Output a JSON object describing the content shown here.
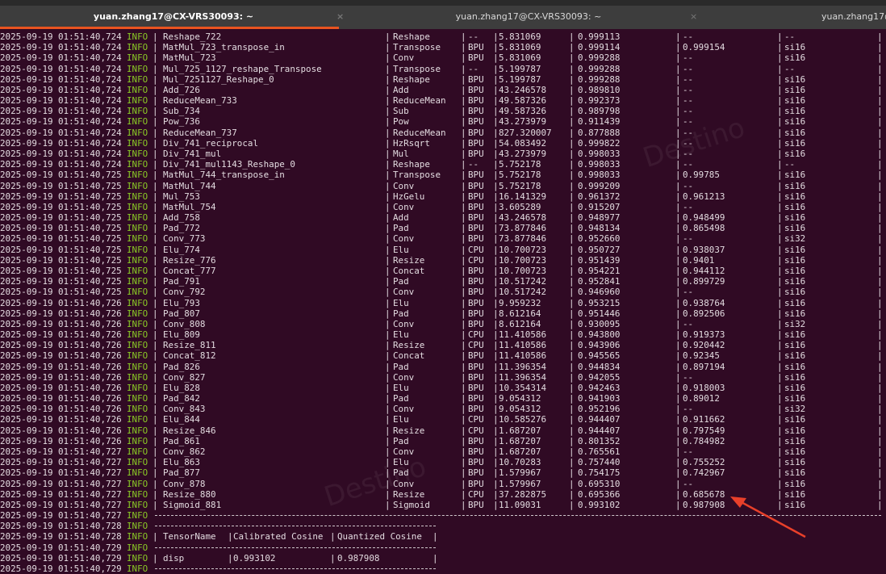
{
  "tabs": [
    {
      "title": "yuan.zhang17@CX-VRS30093: ~",
      "active": true
    },
    {
      "title": "yuan.zhang17@CX-VRS30093: ~",
      "active": false
    },
    {
      "title": "yuan.zhang17@",
      "active": false
    }
  ],
  "close_glyph": "×",
  "accent": "#e95420",
  "background": "#300a24",
  "level_color": "#8ac926",
  "watermark": "Destino",
  "date": "2025-09-19",
  "level": "INFO",
  "rows": [
    [
      "01:51:40,724",
      "Reshape_722",
      "Reshape",
      "--",
      "5.831069",
      "0.999113",
      "--",
      "--"
    ],
    [
      "01:51:40,724",
      "MatMul_723_transpose_in",
      "Transpose",
      "BPU",
      "5.831069",
      "0.999114",
      "0.999154",
      "si16"
    ],
    [
      "01:51:40,724",
      "MatMul_723",
      "Conv",
      "BPU",
      "5.831069",
      "0.999288",
      "--",
      "si16"
    ],
    [
      "01:51:40,724",
      "Mul_725_1127_reshape_Transpose",
      "Transpose",
      "--",
      "5.199787",
      "0.999288",
      "--",
      "--"
    ],
    [
      "01:51:40,724",
      "Mul_7251127_Reshape_0",
      "Reshape",
      "BPU",
      "5.199787",
      "0.999288",
      "--",
      "si16"
    ],
    [
      "01:51:40,724",
      "Add_726",
      "Add",
      "BPU",
      "43.246578",
      "0.989810",
      "--",
      "si16"
    ],
    [
      "01:51:40,724",
      "ReduceMean_733",
      "ReduceMean",
      "BPU",
      "49.587326",
      "0.992373",
      "--",
      "si16"
    ],
    [
      "01:51:40,724",
      "Sub_734",
      "Sub",
      "BPU",
      "49.587326",
      "0.989798",
      "--",
      "si16"
    ],
    [
      "01:51:40,724",
      "Pow_736",
      "Pow",
      "BPU",
      "43.273979",
      "0.911439",
      "--",
      "si16"
    ],
    [
      "01:51:40,724",
      "ReduceMean_737",
      "ReduceMean",
      "BPU",
      "827.320007",
      "0.877888",
      "--",
      "si16"
    ],
    [
      "01:51:40,724",
      "Div_741_reciprocal",
      "HzRsqrt",
      "BPU",
      "54.083492",
      "0.999822",
      "--",
      "si16"
    ],
    [
      "01:51:40,724",
      "Div_741_mul",
      "Mul",
      "BPU",
      "43.273979",
      "0.998033",
      "--",
      "si16"
    ],
    [
      "01:51:40,724",
      "Div_741_mul1143_Reshape_0",
      "Reshape",
      "--",
      "5.752178",
      "0.998033",
      "--",
      "--"
    ],
    [
      "01:51:40,725",
      "MatMul_744_transpose_in",
      "Transpose",
      "BPU",
      "5.752178",
      "0.998033",
      "0.99785",
      "si16"
    ],
    [
      "01:51:40,725",
      "MatMul_744",
      "Conv",
      "BPU",
      "5.752178",
      "0.999209",
      "--",
      "si16"
    ],
    [
      "01:51:40,725",
      "Mul_753",
      "HzGelu",
      "BPU",
      "16.141329",
      "0.961372",
      "0.961213",
      "si16"
    ],
    [
      "01:51:40,725",
      "MatMul_754",
      "Conv",
      "BPU",
      "3.605289",
      "0.915207",
      "--",
      "si16"
    ],
    [
      "01:51:40,725",
      "Add_758",
      "Add",
      "BPU",
      "43.246578",
      "0.948977",
      "0.948499",
      "si16"
    ],
    [
      "01:51:40,725",
      "Pad_772",
      "Pad",
      "BPU",
      "73.877846",
      "0.948134",
      "0.865498",
      "si16"
    ],
    [
      "01:51:40,725",
      "Conv_773",
      "Conv",
      "BPU",
      "73.877846",
      "0.952660",
      "--",
      "si32"
    ],
    [
      "01:51:40,725",
      "Elu_774",
      "Elu",
      "CPU",
      "10.700723",
      "0.950727",
      "0.938037",
      "si16"
    ],
    [
      "01:51:40,725",
      "Resize_776",
      "Resize",
      "CPU",
      "10.700723",
      "0.951439",
      "0.9401",
      "si16"
    ],
    [
      "01:51:40,725",
      "Concat_777",
      "Concat",
      "BPU",
      "10.700723",
      "0.954221",
      "0.944112",
      "si16"
    ],
    [
      "01:51:40,725",
      "Pad_791",
      "Pad",
      "BPU",
      "10.517242",
      "0.952841",
      "0.899729",
      "si16"
    ],
    [
      "01:51:40,725",
      "Conv_792",
      "Conv",
      "BPU",
      "10.517242",
      "0.946960",
      "--",
      "si16"
    ],
    [
      "01:51:40,726",
      "Elu_793",
      "Elu",
      "BPU",
      "9.959232",
      "0.953215",
      "0.938764",
      "si16"
    ],
    [
      "01:51:40,726",
      "Pad_807",
      "Pad",
      "BPU",
      "8.612164",
      "0.951446",
      "0.892506",
      "si16"
    ],
    [
      "01:51:40,726",
      "Conv_808",
      "Conv",
      "BPU",
      "8.612164",
      "0.930095",
      "--",
      "si32"
    ],
    [
      "01:51:40,726",
      "Elu_809",
      "Elu",
      "CPU",
      "11.410586",
      "0.943800",
      "0.919373",
      "si16"
    ],
    [
      "01:51:40,726",
      "Resize_811",
      "Resize",
      "CPU",
      "11.410586",
      "0.943906",
      "0.920442",
      "si16"
    ],
    [
      "01:51:40,726",
      "Concat_812",
      "Concat",
      "BPU",
      "11.410586",
      "0.945565",
      "0.92345",
      "si16"
    ],
    [
      "01:51:40,726",
      "Pad_826",
      "Pad",
      "BPU",
      "11.396354",
      "0.944834",
      "0.897194",
      "si16"
    ],
    [
      "01:51:40,726",
      "Conv_827",
      "Conv",
      "BPU",
      "11.396354",
      "0.942055",
      "--",
      "si16"
    ],
    [
      "01:51:40,726",
      "Elu_828",
      "Elu",
      "BPU",
      "10.354314",
      "0.942463",
      "0.918003",
      "si16"
    ],
    [
      "01:51:40,726",
      "Pad_842",
      "Pad",
      "BPU",
      "9.054312",
      "0.941903",
      "0.89012",
      "si16"
    ],
    [
      "01:51:40,726",
      "Conv_843",
      "Conv",
      "BPU",
      "9.054312",
      "0.952196",
      "--",
      "si32"
    ],
    [
      "01:51:40,726",
      "Elu_844",
      "Elu",
      "CPU",
      "10.585276",
      "0.944407",
      "0.911662",
      "si16"
    ],
    [
      "01:51:40,726",
      "Resize_846",
      "Resize",
      "CPU",
      "1.687207",
      "0.944407",
      "0.797549",
      "si16"
    ],
    [
      "01:51:40,726",
      "Pad_861",
      "Pad",
      "BPU",
      "1.687207",
      "0.801352",
      "0.784982",
      "si16"
    ],
    [
      "01:51:40,727",
      "Conv_862",
      "Conv",
      "BPU",
      "1.687207",
      "0.765561",
      "--",
      "si16"
    ],
    [
      "01:51:40,727",
      "Elu_863",
      "Elu",
      "BPU",
      "10.70283",
      "0.757440",
      "0.755252",
      "si16"
    ],
    [
      "01:51:40,727",
      "Pad_877",
      "Pad",
      "BPU",
      "1.579967",
      "0.754175",
      "0.742967",
      "si16"
    ],
    [
      "01:51:40,727",
      "Conv_878",
      "Conv",
      "BPU",
      "1.579967",
      "0.695310",
      "--",
      "si16"
    ],
    [
      "01:51:40,727",
      "Resize_880",
      "Resize",
      "CPU",
      "37.282875",
      "0.695366",
      "0.685678",
      "si16"
    ],
    [
      "01:51:40,727",
      "Sigmoid_881",
      "Sigmoid",
      "BPU",
      "11.09031",
      "0.993102",
      "0.987908",
      "si16"
    ]
  ],
  "footer_times": [
    "01:51:40,727",
    "01:51:40,728",
    "01:51:40,728",
    "01:51:40,729",
    "01:51:40,729",
    "01:51:40,729"
  ],
  "summary": {
    "headers": [
      "TensorName",
      "Calibrated Cosine",
      "Quantized Cosine"
    ],
    "row": [
      "disp",
      "0.993102",
      "0.987908"
    ]
  },
  "annotation": {
    "type": "red-arrow",
    "points_to": "0.685678",
    "color": "#e8402a"
  }
}
